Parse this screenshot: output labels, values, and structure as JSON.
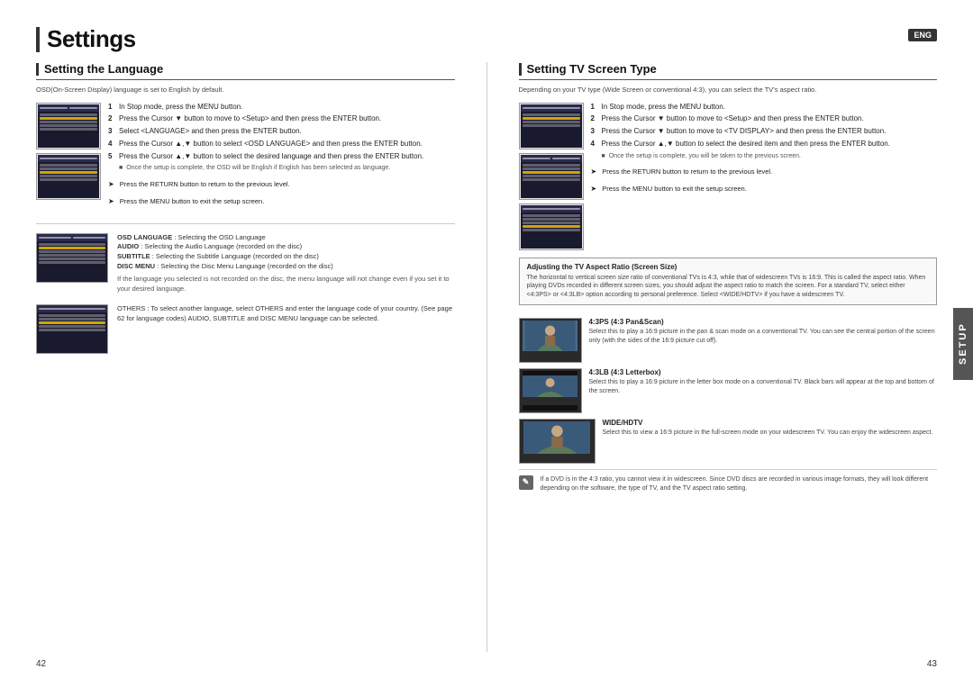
{
  "header": {
    "title": "Settings",
    "badge": "ENG"
  },
  "left_section": {
    "title": "Setting the Language",
    "desc": "OSD(On-Screen Display) language is set to English by default.",
    "steps": [
      {
        "num": "1",
        "text": "In Stop mode, press the MENU button."
      },
      {
        "num": "2",
        "text": "Press the Cursor ▼ button to move to <Setup> and then press the ENTER button."
      },
      {
        "num": "3",
        "text": "Select <LANGUAGE> and then press the ENTER button."
      },
      {
        "num": "4",
        "text": "Press the Cursor ▲,▼ button to select <OSD LANGUAGE> and then press the ENTER button."
      },
      {
        "num": "5",
        "text": "Press the Cursor ▲,▼ button to select the desired language and then press the ENTER button."
      }
    ],
    "note": "Once the setup is complete, the OSD will be English if English has been selected as language.",
    "return_note1": "Press the RETURN button to return to the previous level.",
    "return_note2": "Press the MENU button to exit the setup screen.",
    "lang_info": [
      {
        "title": "OSD LANGUAGE",
        "desc": ": Selecting the OSD Language"
      },
      {
        "title": "AUDIO",
        "desc": ": Selecting the Audio Language (recorded on the disc)"
      },
      {
        "title": "SUBTITLE",
        "desc": ": Selecting the Subtitle Language (recorded on the disc)"
      },
      {
        "title": "DISC MENU",
        "desc": ": Selecting the Disc Menu Language (recorded on the disc)"
      }
    ],
    "lang_note": "If the language you selected is not recorded on the disc, the menu language will not change even if you set it to your desired language.",
    "others_text": "OTHERS : To select another language, select OTHERS and enter the language code of your country. (See page 62 for language codes) AUDIO, SUBTITLE and DISC MENU language can be selected."
  },
  "right_section": {
    "title": "Setting TV Screen Type",
    "desc": "Depending on your TV type (Wide Screen or conventional 4:3), you can select the TV's aspect ratio.",
    "steps": [
      {
        "num": "1",
        "text": "In Stop mode, press the MENU button."
      },
      {
        "num": "2",
        "text": "Press the Cursor ▼ button to move to <Setup> and then press the ENTER button."
      },
      {
        "num": "3",
        "text": "Press the Cursor ▼ button to move to <TV DISPLAY> and then press the ENTER button."
      },
      {
        "num": "4",
        "text": "Press the Cursor ▲,▼ button to select the desired item and then press the ENTER button."
      }
    ],
    "note": "Once the setup is complete, you will be taken to the previous screen.",
    "return_note1": "Press the RETURN button to return to the previous level.",
    "return_note2": "Press the MENU button to exit the setup screen.",
    "aspect_box": {
      "title": "Adjusting the TV Aspect Ratio (Screen Size)",
      "desc": "The horizontal to vertical screen size ratio of conventional TVs is 4:3, while that of widescreen TVs is 16:9. This is called the aspect ratio. When playing DVDs recorded in different screen sizes, you should adjust the aspect ratio to match the screen. For a standard TV, select either <4:3PS> or <4:3LB> option according to personal preference. Select <WIDE/HDTV> if you have a widescreen TV."
    },
    "aspect_items": [
      {
        "label": "4:3PS (4:3 Pan&Scan)",
        "desc": "Select this to play a 16:9 picture in the pan & scan mode on a conventional TV. You can see the central portion of the screen only (with the sides of the 16:9 picture cut off).",
        "type": "panscan"
      },
      {
        "label": "4:3LB (4:3 Letterbox)",
        "desc": "Select this to play a 16:9 picture in the letter box mode on a conventional TV. Black bars will appear at the top and bottom of the screen.",
        "type": "letterbox"
      },
      {
        "label": "WIDE/HDTV",
        "desc": "Select this to view a 16:9 picture in the full-screen mode on your widescreen TV. You can enjoy the widescreen aspect.",
        "type": "wide"
      }
    ],
    "bottom_note": "If a DVD is in the 4:3 ratio, you cannot view it in widescreen.\nSince DVD discs are recorded in various image formats, they will look different depending on the software, the type of TV, and the TV aspect ratio setting."
  },
  "page_numbers": {
    "left": "42",
    "right": "43"
  },
  "setup_tab": "SETUP"
}
